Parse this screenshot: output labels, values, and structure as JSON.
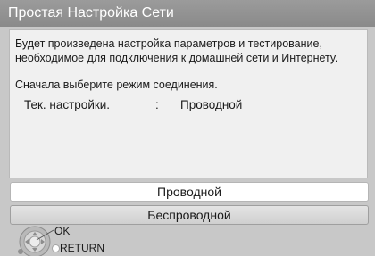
{
  "window": {
    "title": "Простая Настройка Сети"
  },
  "panel": {
    "description": "Будет произведена настройка параметров и тестирование, необходимое для подключения к домашней сети и Интернету.",
    "prompt": "Сначала выберите режим соединения.",
    "current_label": "Тек. настройки.",
    "current_separator": ":",
    "current_value": "Проводной"
  },
  "options": [
    {
      "label": "Проводной",
      "selected": true
    },
    {
      "label": "Беспроводной",
      "selected": false
    }
  ],
  "hints": {
    "ok_label": "OK",
    "return_label": "RETURN"
  },
  "icons": {
    "nav": "dpad-icon",
    "return": "return-dot-icon"
  },
  "colors": {
    "title_bg": "#8f8f8f",
    "panel_bg": "#f0f0f0",
    "selected_bg": "#ffffff"
  }
}
